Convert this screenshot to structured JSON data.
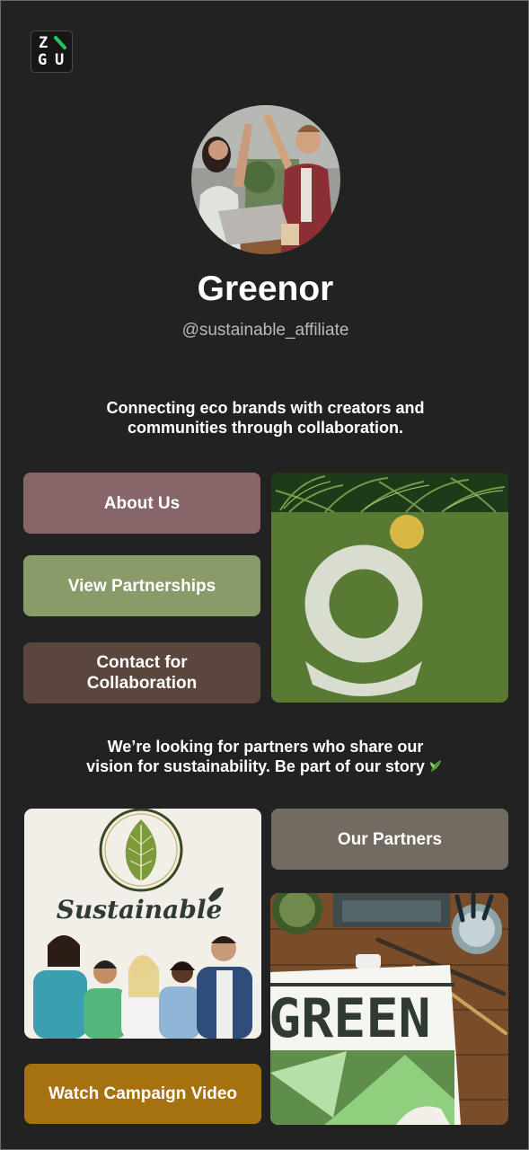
{
  "brand": {
    "logo_text": [
      "Z",
      "G",
      "U"
    ],
    "accent": "#22c55e"
  },
  "profile": {
    "name": "Greenor",
    "handle": "@sustainable_affiliate",
    "tagline_line1": "Connecting eco brands with creators and",
    "tagline_line2": "communities through collaboration."
  },
  "links": {
    "about": "About Us",
    "partnerships": "View Partnerships",
    "contact_line1": "Contact for",
    "contact_line2": "Collaboration",
    "partners": "Our Partners",
    "video": "Watch Campaign Video"
  },
  "cta": {
    "line1": "We’re looking for partners who share our",
    "line2": "vision for sustainability. Be part of our story",
    "emoji_icon": "herb-icon"
  },
  "images": {
    "sustainable_word": "Sustainable",
    "green_word": "GREEN"
  },
  "colors": {
    "background": "#222222",
    "about": "#87666a",
    "partnerships": "#8a9b6a",
    "contact": "#5b463e",
    "partners": "#736a61",
    "video": "#a5720f"
  }
}
